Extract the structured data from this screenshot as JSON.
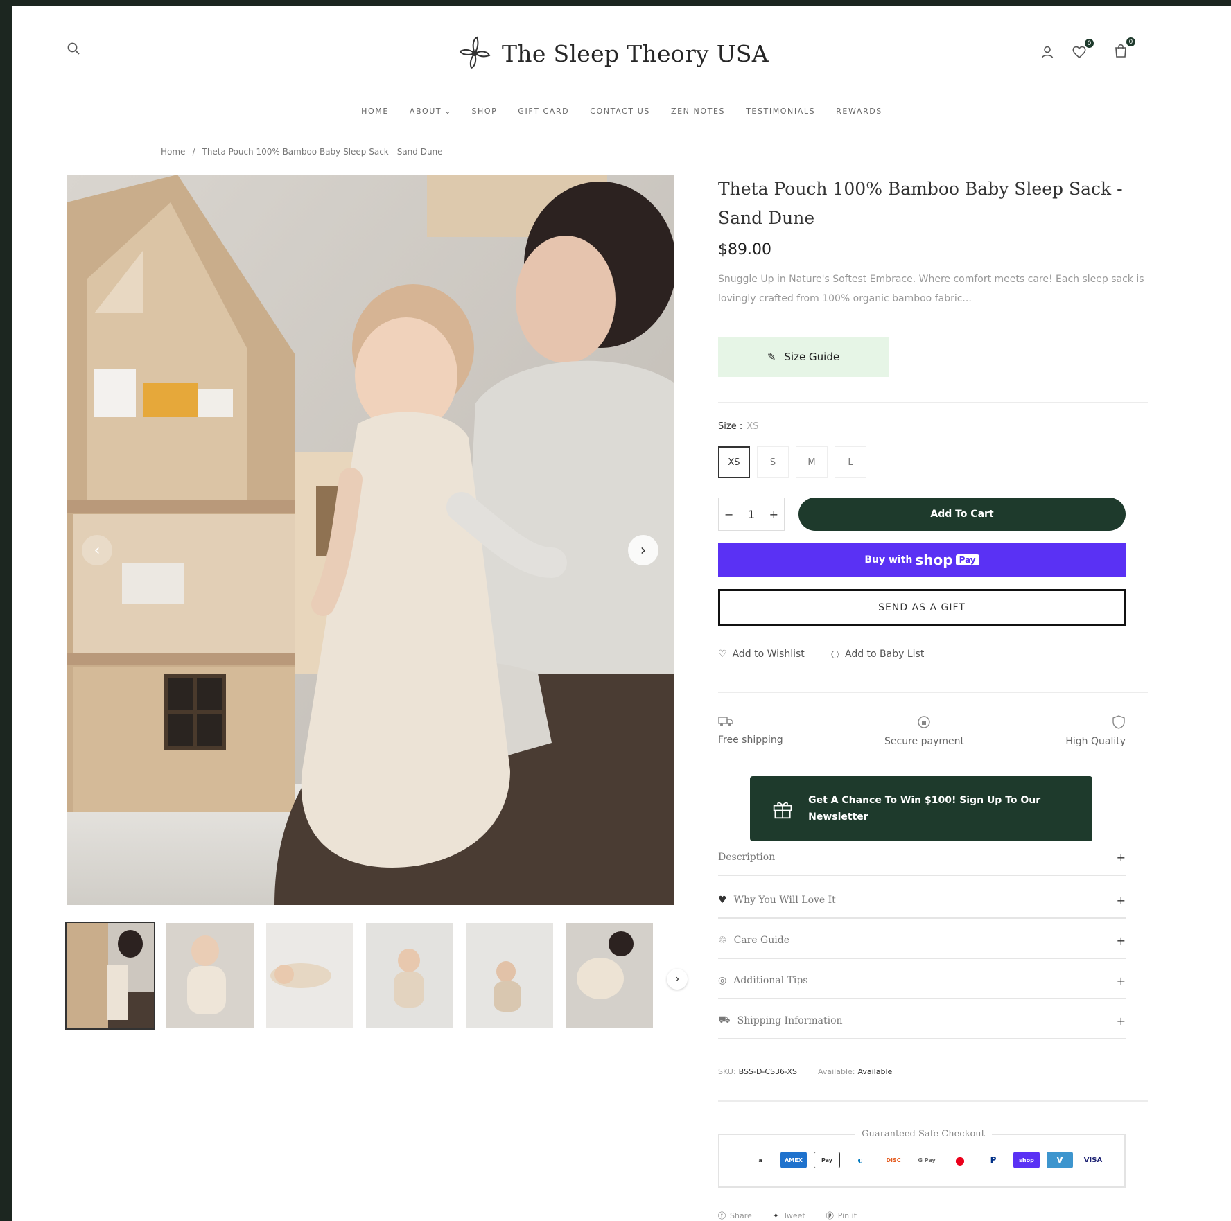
{
  "header": {
    "logo_text": "The Sleep Theory USA",
    "cart_count": "0",
    "wishlist_count": "0"
  },
  "nav": [
    "HOME",
    "ABOUT",
    "SHOP",
    "GIFT CARD",
    "CONTACT US",
    "ZEN NOTES",
    "TESTIMONIALS",
    "REWARDS"
  ],
  "breadcrumb": {
    "home": "Home",
    "separator": "/",
    "current": "Theta Pouch 100% Bamboo Baby Sleep Sack - Sand Dune"
  },
  "product": {
    "title": "Theta Pouch 100% Bamboo Baby Sleep Sack - Sand Dune",
    "price": "$89.00",
    "description": "Snuggle Up in Nature's Softest Embrace. Where comfort meets care! Each sleep sack is lovingly crafted from 100% organic bamboo fabric...",
    "size_guide_label": "Size Guide",
    "size_label": "Size :",
    "selected_size": "XS",
    "sizes": [
      "XS",
      "S",
      "M",
      "L"
    ],
    "quantity": "1",
    "add_to_cart": "Add To Cart",
    "shop_pay": {
      "buy_with": "Buy with",
      "shop": "shop",
      "pay": "Pay"
    },
    "send_gift": "SEND AS A GIFT",
    "add_wishlist": "Add to Wishlist",
    "add_baby_list": "Add to Baby List"
  },
  "features": [
    "Free shipping",
    "Secure payment",
    "High Quality"
  ],
  "newsletter": "Get A Chance To Win $100! Sign Up To Our Newsletter",
  "accordions": [
    "Description",
    "Why You Will Love It",
    "Care Guide",
    "Additional Tips",
    "Shipping Information"
  ],
  "meta": {
    "sku_label": "SKU:",
    "sku": "BSS-D-CS36-XS",
    "availability_label": "Available:",
    "availability": "Available"
  },
  "checkout": {
    "title": "Guaranteed Safe Checkout",
    "methods": [
      "Amazon",
      "Amex",
      "Apple Pay",
      "Diners",
      "Discover",
      "G Pay",
      "Mastercard",
      "PayPal",
      "Shop Pay",
      "Venmo",
      "Visa"
    ]
  },
  "share": [
    "Share",
    "Tweet",
    "Pin it"
  ],
  "colors": {
    "brand_green": "#1e3a2c",
    "shop_pay": "#5a31f4",
    "size_guide_bg": "#e6f5e6"
  }
}
